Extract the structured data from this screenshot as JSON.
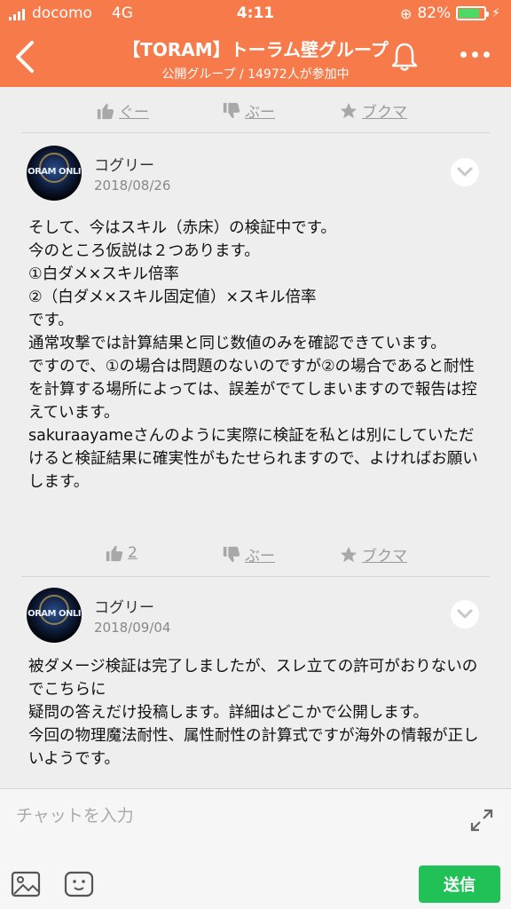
{
  "status_bar": {
    "carrier": "docomo",
    "network": "4G",
    "time": "4:11",
    "battery": "82%",
    "battery_level": 0.82
  },
  "header": {
    "title": "【TORAM】トーラム壁グループ",
    "subtitle": "公開グループ / 14972人が参加中",
    "accent_color": "#f77a4b"
  },
  "reaction_labels": {
    "good": "ぐー",
    "boo": "ぶー",
    "bookmark": "ブクマ"
  },
  "posts": [
    {
      "author": "コグリー",
      "date": "2018/08/26",
      "avatar_text": "ORAM ONLI",
      "body": "そして、今はスキル（赤床）の検証中です。\n今のところ仮説は２つあります。\n①白ダメ×スキル倍率\n②（白ダメ×スキル固定値）×スキル倍率\nです。\n通常攻撃では計算結果と同じ数値のみを確認できています。\nですので、①の場合は問題のないのですが②の場合であると耐性を計算する場所によっては、誤差がでてしまいますので報告は控えています。\nsakuraayameさんのように実際に検証を私とは別にしていただけると検証結果に確実性がもたせられますので、よければお願いします。",
      "good_count": "2"
    },
    {
      "author": "コグリー",
      "date": "2018/09/04",
      "avatar_text": "ORAM ONLI",
      "body": "被ダメージ検証は完了しましたが、スレ立ての許可がおりないのでこちらに\n疑問の答えだけ投稿します。詳細はどこかで公開します。\n今回の物理魔法耐性、属性耐性の計算式ですが海外の情報が正しいようです。"
    }
  ],
  "composer": {
    "placeholder": "チャットを入力",
    "send_label": "送信",
    "send_color": "#21c157"
  }
}
